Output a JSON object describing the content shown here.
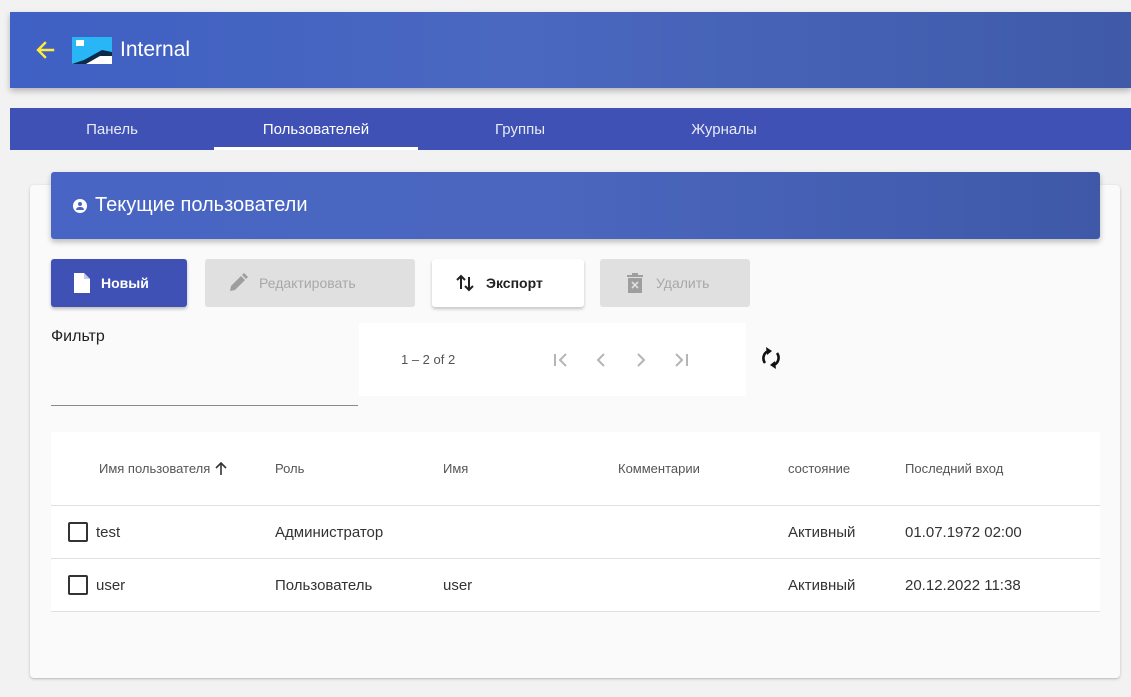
{
  "appbar": {
    "title": "Internal",
    "back_icon": "arrow-left-icon",
    "back_color": "#ffeb3b"
  },
  "tabs": [
    {
      "label": "Панель",
      "active": false
    },
    {
      "label": "Пользователей",
      "active": true
    },
    {
      "label": "Группы",
      "active": false
    },
    {
      "label": "Журналы",
      "active": false
    }
  ],
  "card": {
    "title": "Текущие пользователи",
    "icon": "account-circle-icon"
  },
  "toolbar": {
    "new_label": "Новый",
    "edit_label": "Редактировать",
    "export_label": "Экспорт",
    "delete_label": "Удалить"
  },
  "filter": {
    "label": "Фильтр",
    "value": ""
  },
  "paginator": {
    "range_label": "1 – 2 of 2"
  },
  "table": {
    "columns": {
      "username": "Имя пользователя",
      "role": "Роль",
      "name": "Имя",
      "comments": "Комментарии",
      "state": "состояние",
      "last_login": "Последний вход"
    },
    "rows": [
      {
        "username": "test",
        "role": "Администратор",
        "name": "",
        "comments": "",
        "state": "Активный",
        "last_login": "01.07.1972 02:00",
        "checked": false
      },
      {
        "username": "user",
        "role": "Пользователь",
        "name": "user",
        "comments": "",
        "state": "Активный",
        "last_login": "20.12.2022 11:38",
        "checked": false
      }
    ]
  },
  "colors": {
    "primary": "#3f51b5",
    "appbar": "#4865c5",
    "disabled_bg": "#e0e0e0",
    "disabled_text": "#a8a8a8"
  }
}
